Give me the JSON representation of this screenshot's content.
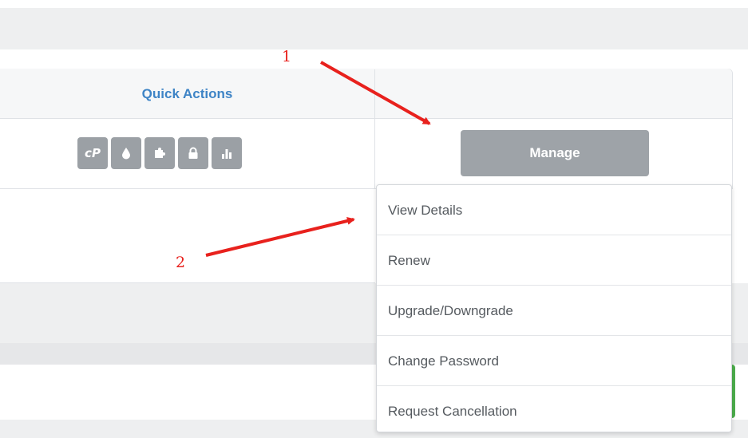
{
  "table": {
    "quick_actions_header": "Quick Actions",
    "quick_action_icons": [
      {
        "icon": "cpanel-icon",
        "glyph": "cP"
      },
      {
        "icon": "droplet-icon",
        "glyph": "💧"
      },
      {
        "icon": "puzzle-icon",
        "glyph": "puzzle"
      },
      {
        "icon": "lock-icon",
        "glyph": "lock"
      },
      {
        "icon": "bar-chart-icon",
        "glyph": "chart"
      }
    ],
    "manage_label": "Manage"
  },
  "dropdown": {
    "items": [
      {
        "label": "View Details"
      },
      {
        "label": "Renew"
      },
      {
        "label": "Upgrade/Downgrade"
      },
      {
        "label": "Change Password"
      },
      {
        "label": "Request Cancellation"
      }
    ]
  },
  "annotations": {
    "marker_1": "1",
    "marker_2": "2",
    "arrow_color": "#e8211d"
  },
  "colors": {
    "accent_blue": "#3e84c6",
    "button_gray": "#9ea3a8",
    "success_green": "#4cae4c"
  }
}
